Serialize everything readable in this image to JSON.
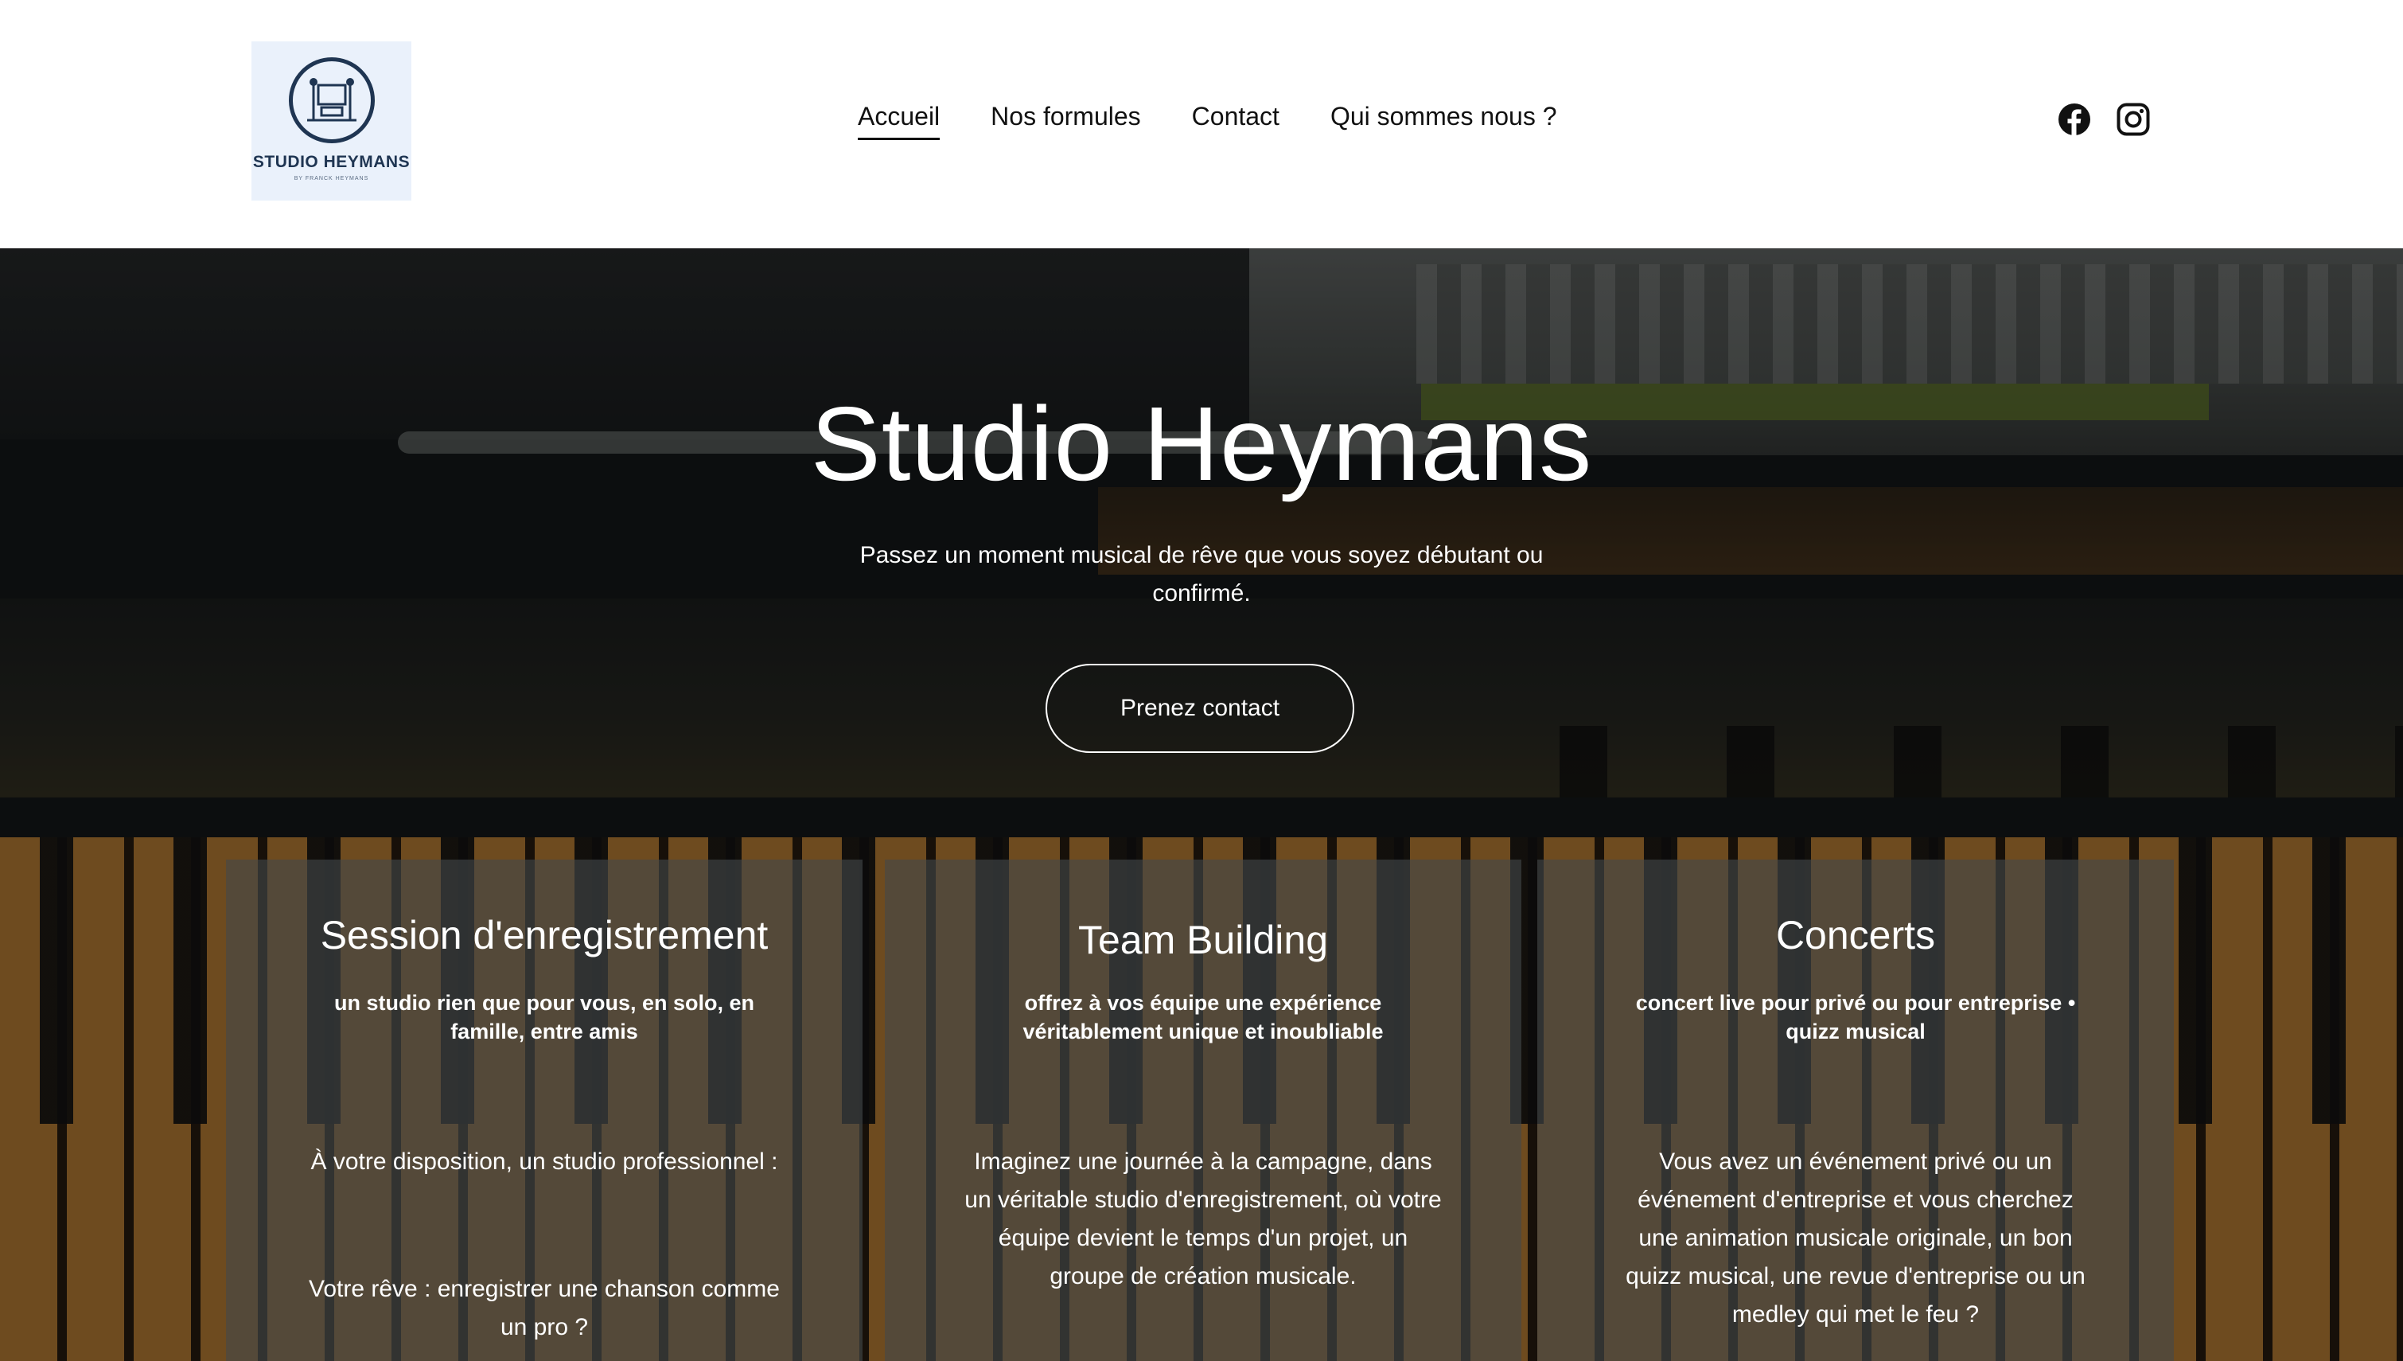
{
  "brand": {
    "logo_title": "STUDIO HEYMANS",
    "logo_subtitle": "BY FRANCK HEYMANS",
    "logo_color": "#1f3552",
    "logo_background": "#eaf1fb"
  },
  "nav": {
    "items": [
      {
        "label": "Accueil",
        "active": true
      },
      {
        "label": "Nos formules",
        "active": false
      },
      {
        "label": "Contact",
        "active": false
      },
      {
        "label": "Qui sommes nous ?",
        "active": false
      }
    ]
  },
  "social": [
    {
      "icon": "facebook-icon"
    },
    {
      "icon": "instagram-icon"
    }
  ],
  "hero": {
    "title": "Studio Heymans",
    "subtitle": "Passez un moment musical de rêve que vous soyez débutant ou confirmé.",
    "cta_label": "Prenez contact"
  },
  "cards": [
    {
      "title": "Session d'enregistrement",
      "tagline": "un studio rien que pour vous, en solo, en famille, entre amis",
      "paragraphs": [
        "À votre disposition, un studio professionnel :",
        "Votre rêve : enregistrer une chanson comme un pro ?"
      ]
    },
    {
      "title": "Team Building",
      "tagline": "offrez à vos équipe une expérience véritablement unique et inoubliable",
      "paragraphs": [
        "Imaginez une journée à la campagne, dans un véritable studio d'enregistrement, où votre équipe devient le temps d'un projet, un groupe de création musicale."
      ]
    },
    {
      "title": "Concerts",
      "tagline": "concert live pour privé ou pour entreprise • quizz musical",
      "paragraphs": [
        "Vous avez un événement privé ou un événement d'entreprise et vous cherchez une animation musicale originale, un bon quizz musical, une revue d'entreprise ou un medley qui met le feu ?"
      ]
    }
  ]
}
